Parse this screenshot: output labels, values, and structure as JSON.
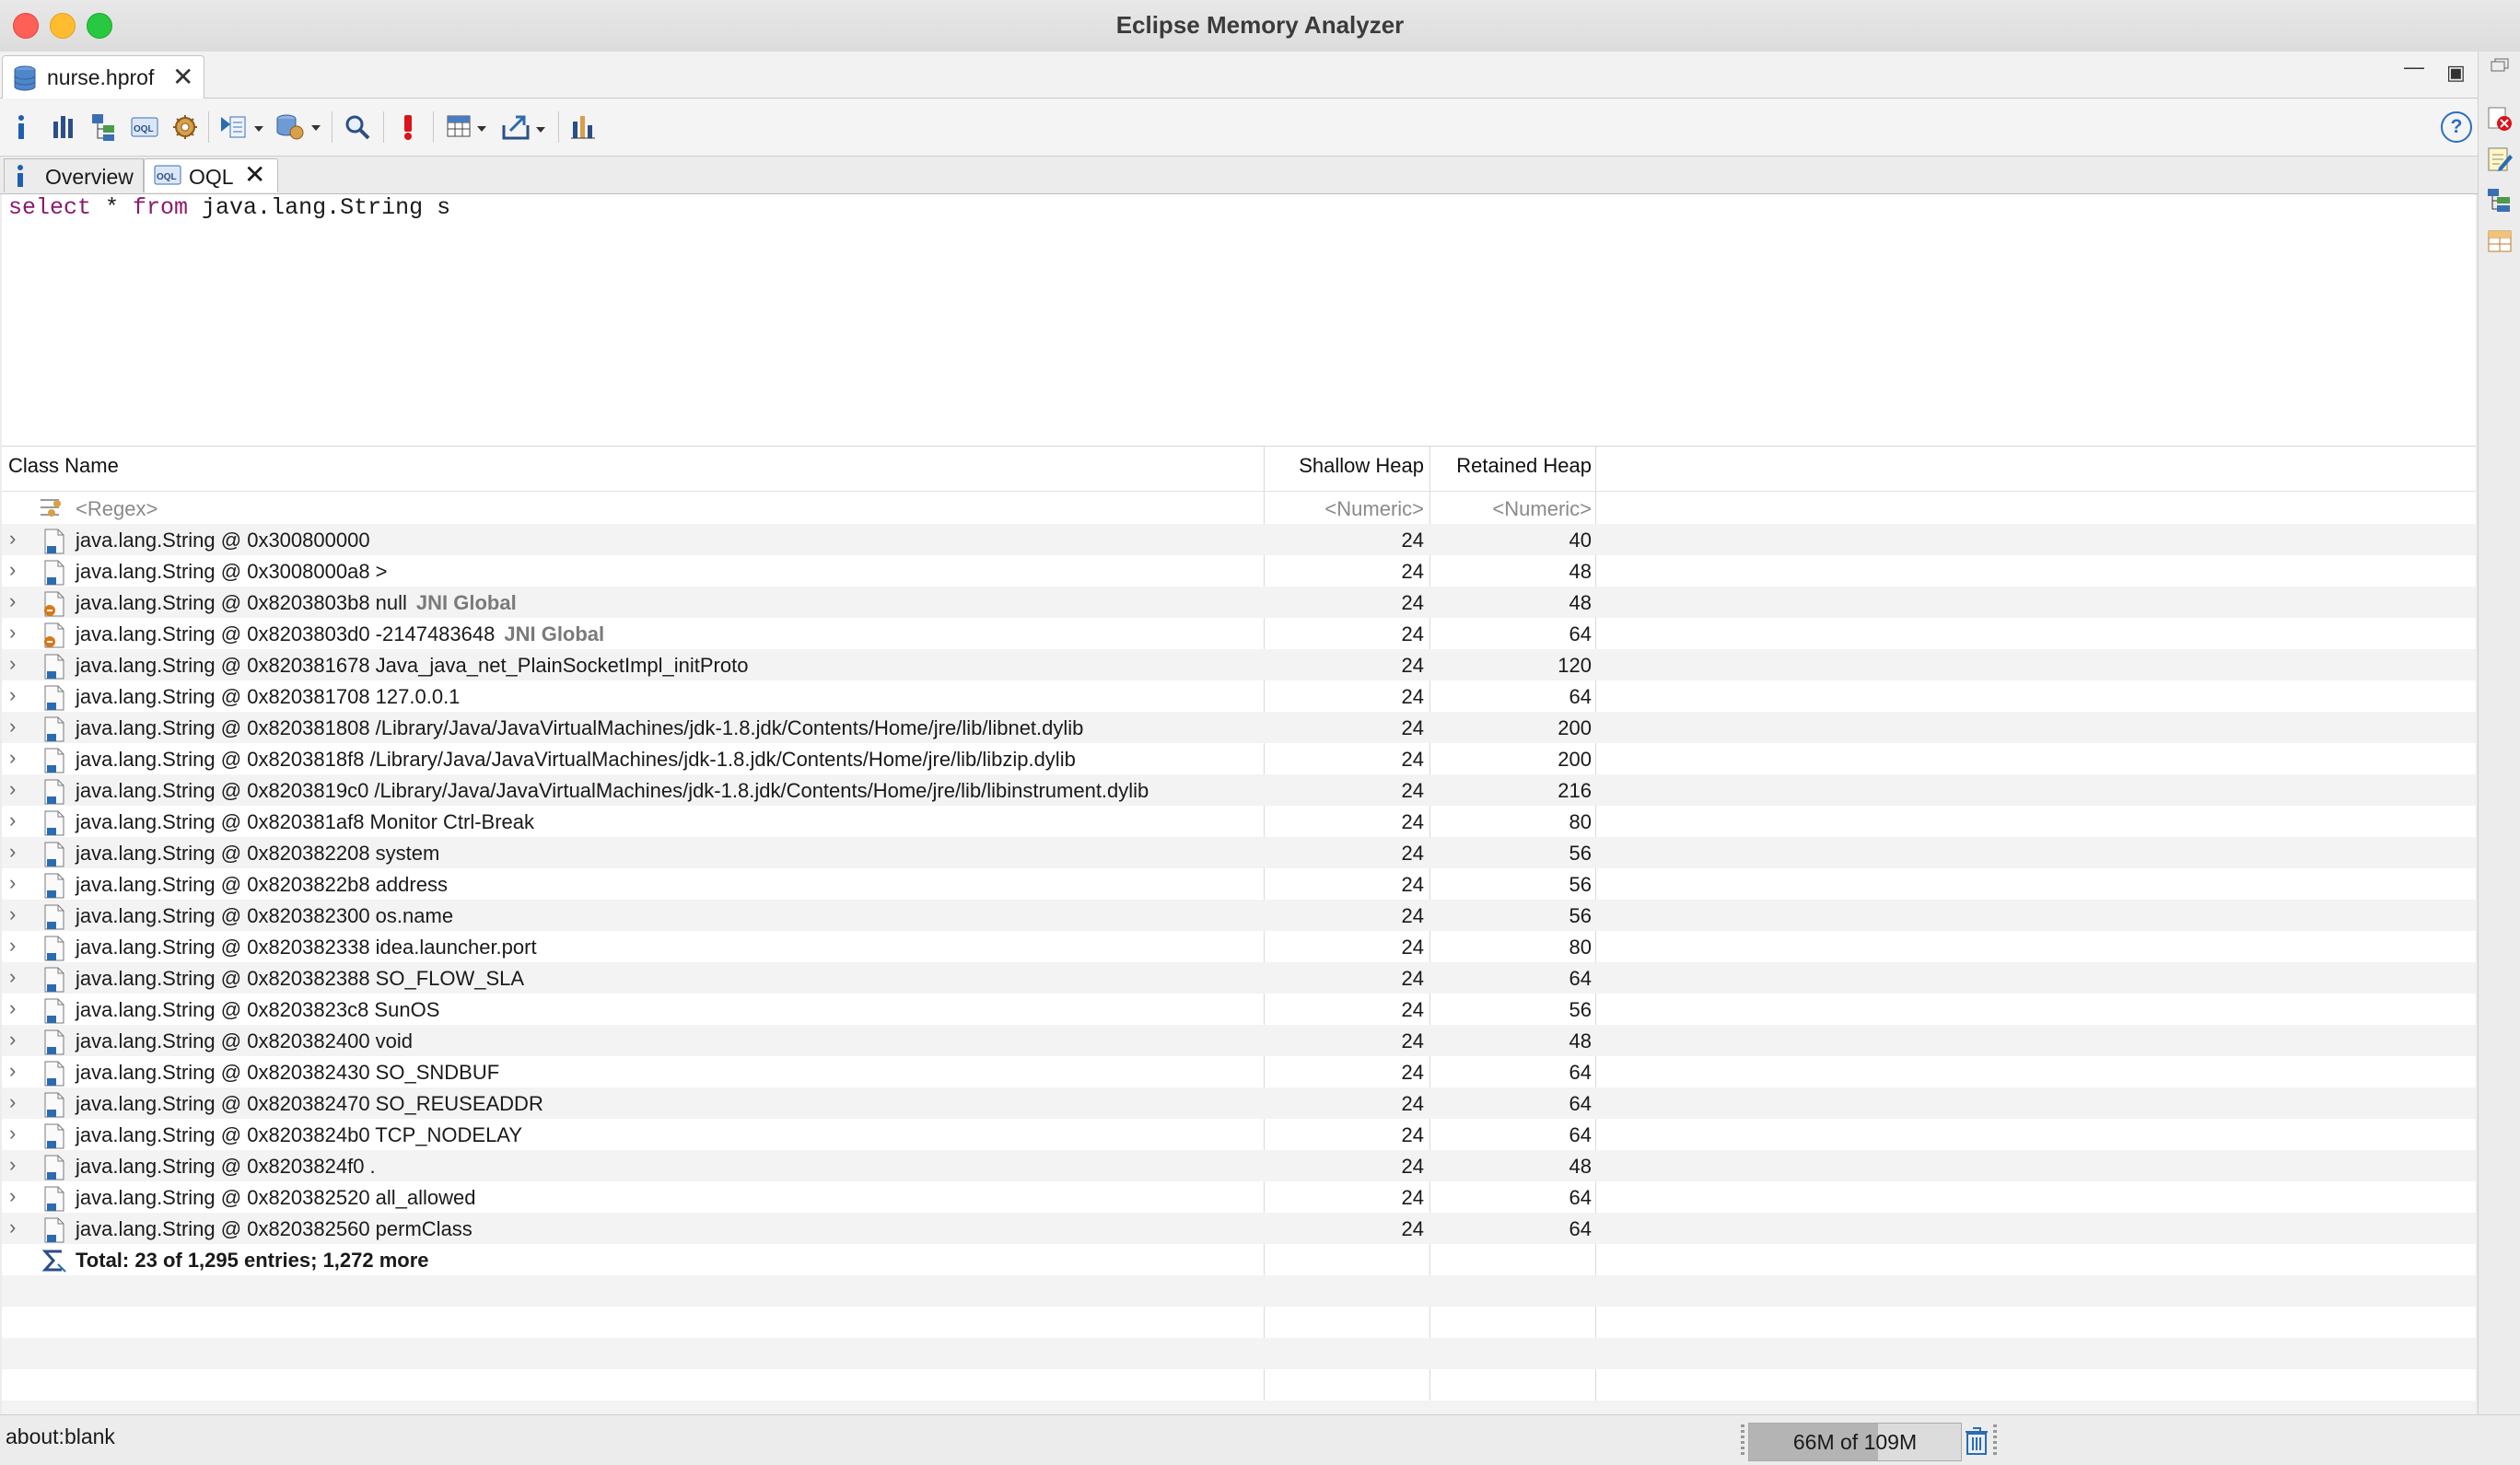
{
  "window": {
    "title": "Eclipse Memory Analyzer"
  },
  "editor_tab": {
    "label": "nurse.hprof",
    "close": "✕"
  },
  "toolbar": {
    "icons": [
      "info-icon",
      "histogram-icon",
      "dominator-tree-icon",
      "oql-icon",
      "thread-overview-icon",
      "reports-icon",
      "query-browser-icon",
      "search-icon",
      "leak-suspects-icon",
      "calculate-icon",
      "export-icon",
      "compare-icon"
    ],
    "help": "?"
  },
  "inner_tabs": {
    "overview": "Overview",
    "oql": "OQL",
    "close": "✕"
  },
  "query": {
    "kw1": "select",
    "mid1": " * ",
    "kw2": "from",
    "rest": " java.lang.String s"
  },
  "table": {
    "columns": {
      "class_name": "Class Name",
      "shallow": "Shallow Heap",
      "retained": "Retained Heap"
    },
    "filter": {
      "regex": "<Regex>",
      "shallow": "<Numeric>",
      "retained": "<Numeric>"
    },
    "rows": [
      {
        "name": "java.lang.String @ 0x300800000",
        "gc": "",
        "shallow": "24",
        "retained": "40"
      },
      {
        "name": "java.lang.String @ 0x3008000a8  >",
        "gc": "",
        "shallow": "24",
        "retained": "48"
      },
      {
        "name": "java.lang.String @ 0x8203803b8  null",
        "gc": "JNI Global",
        "shallow": "24",
        "retained": "48"
      },
      {
        "name": "java.lang.String @ 0x8203803d0  -2147483648",
        "gc": "JNI Global",
        "shallow": "24",
        "retained": "64"
      },
      {
        "name": "java.lang.String @ 0x820381678  Java_java_net_PlainSocketImpl_initProto",
        "gc": "",
        "shallow": "24",
        "retained": "120"
      },
      {
        "name": "java.lang.String @ 0x820381708  127.0.0.1",
        "gc": "",
        "shallow": "24",
        "retained": "64"
      },
      {
        "name": "java.lang.String @ 0x820381808  /Library/Java/JavaVirtualMachines/jdk-1.8.jdk/Contents/Home/jre/lib/libnet.dylib",
        "gc": "",
        "shallow": "24",
        "retained": "200"
      },
      {
        "name": "java.lang.String @ 0x8203818f8  /Library/Java/JavaVirtualMachines/jdk-1.8.jdk/Contents/Home/jre/lib/libzip.dylib",
        "gc": "",
        "shallow": "24",
        "retained": "200"
      },
      {
        "name": "java.lang.String @ 0x8203819c0  /Library/Java/JavaVirtualMachines/jdk-1.8.jdk/Contents/Home/jre/lib/libinstrument.dylib",
        "gc": "",
        "shallow": "24",
        "retained": "216"
      },
      {
        "name": "java.lang.String @ 0x820381af8  Monitor Ctrl-Break",
        "gc": "",
        "shallow": "24",
        "retained": "80"
      },
      {
        "name": "java.lang.String @ 0x820382208  system",
        "gc": "",
        "shallow": "24",
        "retained": "56"
      },
      {
        "name": "java.lang.String @ 0x8203822b8  address",
        "gc": "",
        "shallow": "24",
        "retained": "56"
      },
      {
        "name": "java.lang.String @ 0x820382300  os.name",
        "gc": "",
        "shallow": "24",
        "retained": "56"
      },
      {
        "name": "java.lang.String @ 0x820382338  idea.launcher.port",
        "gc": "",
        "shallow": "24",
        "retained": "80"
      },
      {
        "name": "java.lang.String @ 0x820382388  SO_FLOW_SLA",
        "gc": "",
        "shallow": "24",
        "retained": "64"
      },
      {
        "name": "java.lang.String @ 0x8203823c8  SunOS",
        "gc": "",
        "shallow": "24",
        "retained": "56"
      },
      {
        "name": "java.lang.String @ 0x820382400  void",
        "gc": "",
        "shallow": "24",
        "retained": "48"
      },
      {
        "name": "java.lang.String @ 0x820382430  SO_SNDBUF",
        "gc": "",
        "shallow": "24",
        "retained": "64"
      },
      {
        "name": "java.lang.String @ 0x820382470  SO_REUSEADDR",
        "gc": "",
        "shallow": "24",
        "retained": "64"
      },
      {
        "name": "java.lang.String @ 0x8203824b0  TCP_NODELAY",
        "gc": "",
        "shallow": "24",
        "retained": "64"
      },
      {
        "name": "java.lang.String @ 0x8203824f0  .",
        "gc": "",
        "shallow": "24",
        "retained": "48"
      },
      {
        "name": "java.lang.String @ 0x820382520  all_allowed",
        "gc": "",
        "shallow": "24",
        "retained": "64"
      },
      {
        "name": "java.lang.String @ 0x820382560  permClass",
        "gc": "",
        "shallow": "24",
        "retained": "64"
      }
    ],
    "total": "Total: 23 of 1,295 entries; 1,272 more"
  },
  "status": {
    "text": "about:blank",
    "heap": "66M of 109M",
    "heap_used_fraction": 0.61
  },
  "colors": {
    "keyword": "#8b1a6b",
    "accent": "#2a6fc0",
    "gc_root": "#7a7a7a"
  }
}
